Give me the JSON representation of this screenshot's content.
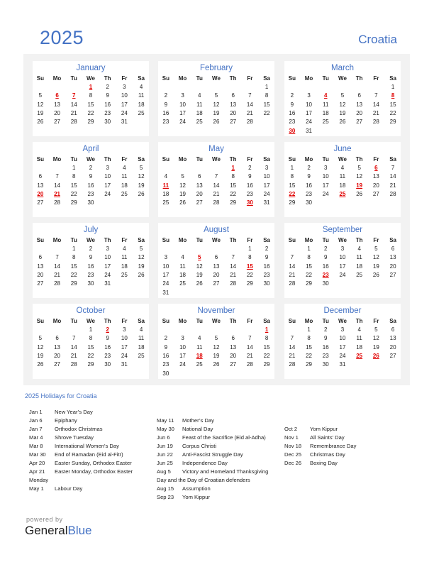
{
  "header": {
    "year": "2025",
    "country": "Croatia"
  },
  "weekday_labels": [
    "Su",
    "Mo",
    "Tu",
    "We",
    "Th",
    "Fr",
    "Sa"
  ],
  "accent_color": "#4472c4",
  "holiday_color": "#e00000",
  "months": [
    {
      "name": "January",
      "start": 3,
      "days": 31,
      "holidays": [
        1,
        6,
        7
      ]
    },
    {
      "name": "February",
      "start": 6,
      "days": 28,
      "holidays": []
    },
    {
      "name": "March",
      "start": 6,
      "days": 31,
      "holidays": [
        4,
        8,
        30
      ]
    },
    {
      "name": "April",
      "start": 2,
      "days": 30,
      "holidays": [
        20,
        21
      ]
    },
    {
      "name": "May",
      "start": 4,
      "days": 31,
      "holidays": [
        1,
        11,
        30
      ]
    },
    {
      "name": "June",
      "start": 0,
      "days": 30,
      "holidays": [
        6,
        19,
        22,
        25
      ]
    },
    {
      "name": "July",
      "start": 2,
      "days": 31,
      "holidays": []
    },
    {
      "name": "August",
      "start": 5,
      "days": 31,
      "holidays": [
        5,
        15
      ]
    },
    {
      "name": "September",
      "start": 1,
      "days": 30,
      "holidays": [
        23
      ]
    },
    {
      "name": "October",
      "start": 3,
      "days": 31,
      "holidays": [
        2
      ]
    },
    {
      "name": "November",
      "start": 6,
      "days": 30,
      "holidays": [
        1,
        18
      ]
    },
    {
      "name": "December",
      "start": 1,
      "days": 31,
      "holidays": [
        25,
        26
      ]
    }
  ],
  "holidays_title": "2025 Holidays for Croatia",
  "holiday_columns": [
    [
      {
        "date": "Jan 1",
        "name": "New Year’s Day"
      },
      {
        "date": "Jan 6",
        "name": "Epiphany"
      },
      {
        "date": "Jan 7",
        "name": "Orthodox Christmas"
      },
      {
        "date": "Mar 4",
        "name": "Shrove Tuesday"
      },
      {
        "date": "Mar 8",
        "name": "International Women’s Day"
      },
      {
        "date": "Mar 30",
        "name": "End of Ramadan (Eid al-Fitr)"
      },
      {
        "date": "Apr 20",
        "name": "Easter Sunday, Orthodox Easter"
      },
      {
        "date": "Apr 21",
        "name": "Easter Monday, Orthodox Easter"
      },
      {
        "date": "",
        "name": "Monday",
        "wrap": true
      },
      {
        "date": "May 1",
        "name": "Labour Day"
      }
    ],
    [
      {
        "date": "May 11",
        "name": "Mother’s Day"
      },
      {
        "date": "May 30",
        "name": "National Day"
      },
      {
        "date": "Jun 6",
        "name": "Feast of the Sacrifice (Eid al-Adha)"
      },
      {
        "date": "Jun 19",
        "name": "Corpus Christi"
      },
      {
        "date": "Jun 22",
        "name": "Anti-Fascist Struggle Day"
      },
      {
        "date": "Jun 25",
        "name": "Independence Day"
      },
      {
        "date": "Aug 5",
        "name": "Victory and Homeland Thanksgiving"
      },
      {
        "date": "",
        "name": "Day and the Day of Croatian defenders",
        "wrap": true
      },
      {
        "date": "Aug 15",
        "name": "Assumption"
      },
      {
        "date": "Sep 23",
        "name": "Yom Kippur"
      }
    ],
    [
      {
        "date": "Oct 2",
        "name": "Yom Kippur"
      },
      {
        "date": "Nov 1",
        "name": "All Saints’ Day"
      },
      {
        "date": "Nov 18",
        "name": "Remembrance Day"
      },
      {
        "date": "Dec 25",
        "name": "Christmas Day"
      },
      {
        "date": "Dec 26",
        "name": "Boxing Day"
      }
    ]
  ],
  "footer": {
    "powered_by": "powered by",
    "brand_part1": "General",
    "brand_part2": "Blue"
  }
}
